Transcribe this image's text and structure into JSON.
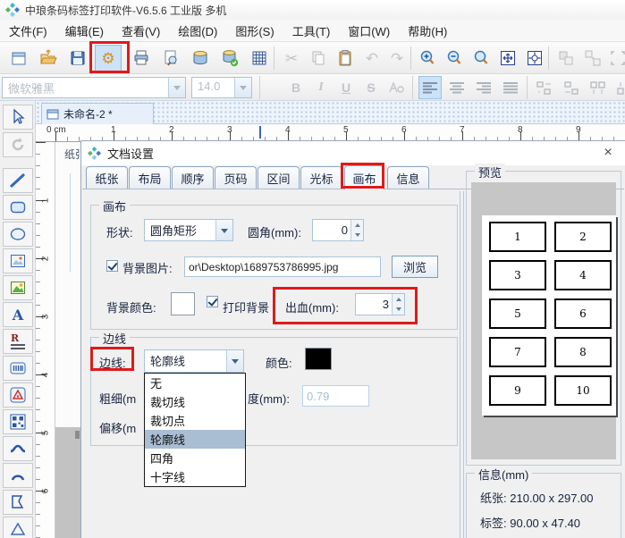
{
  "window": {
    "title": "中琅条码标签打印软件-V6.5.6 工业版 多机"
  },
  "menu": {
    "items": [
      "文件(F)",
      "编辑(E)",
      "查看(V)",
      "绘图(D)",
      "图形(S)",
      "工具(T)",
      "窗口(W)",
      "帮助(H)"
    ]
  },
  "toolbar_icons": {
    "settings_glyph": "⚙",
    "cut_glyph": "✂",
    "undo_glyph": "↶",
    "redo_glyph": "↷"
  },
  "format_bar": {
    "font_name": "微软雅黑",
    "font_size": "14.0",
    "bold": "B",
    "italic": "I",
    "underline": "U",
    "strike": "S"
  },
  "left_tools": {
    "text_glyph": "A",
    "rich_glyph": "R"
  },
  "document_tab": {
    "label": "未命名-2 *"
  },
  "ruler": {
    "origin_label": "0 cm",
    "h_numbers": [
      "1",
      "2",
      "3",
      "4",
      "5",
      "6",
      "7",
      "8",
      "9"
    ],
    "v_numbers": [
      "1",
      "2",
      "3",
      "4",
      "5",
      "6"
    ]
  },
  "canvas_fragment": {
    "text": "纸张"
  },
  "dialog": {
    "title": "文档设置",
    "close_glyph": "×",
    "tabs": [
      "纸张",
      "布局",
      "顺序",
      "页码",
      "区间",
      "光标",
      "画布",
      "信息"
    ],
    "selected_tab": "画布",
    "canvas_group": {
      "title": "画布",
      "shape_label": "形状:",
      "shape_value": "圆角矩形",
      "corner_label": "圆角(mm):",
      "corner_value": "0",
      "bg_image_label": "背景图片:",
      "bg_image_value": "or\\Desktop\\1689753786995.jpg",
      "browse_button": "浏览",
      "bg_color_label": "背景颜色:",
      "print_bg_label": "打印背景",
      "bleed_label": "出血(mm):",
      "bleed_value": "3"
    },
    "border_group": {
      "title": "边线",
      "line_label": "边线:",
      "line_value": "轮廓线",
      "color_label": "颜色:",
      "thickness_label_clipped": "粗细(m",
      "width_label_clipped": "度(mm):",
      "width_value": "0.79",
      "offset_label_clipped": "偏移(m"
    },
    "line_dropdown": {
      "items": [
        "无",
        "裁切线",
        "裁切点",
        "轮廓线",
        "四角",
        "十字线"
      ],
      "selected": "轮廓线"
    },
    "preview_group": {
      "title": "预览",
      "labels": [
        "1",
        "2",
        "3",
        "4",
        "5",
        "6",
        "7",
        "8",
        "9",
        "10"
      ]
    },
    "info_group": {
      "title": "信息(mm)",
      "paper_label": "纸张:",
      "paper_value": "210.00 x 297.00",
      "label_label": "标签:",
      "label_value": "90.00 x 47.40"
    }
  },
  "colors": {
    "annotation": "#e01a1a",
    "accent": "#3a6ab8",
    "selected_item_bg": "#a9bdd3"
  }
}
